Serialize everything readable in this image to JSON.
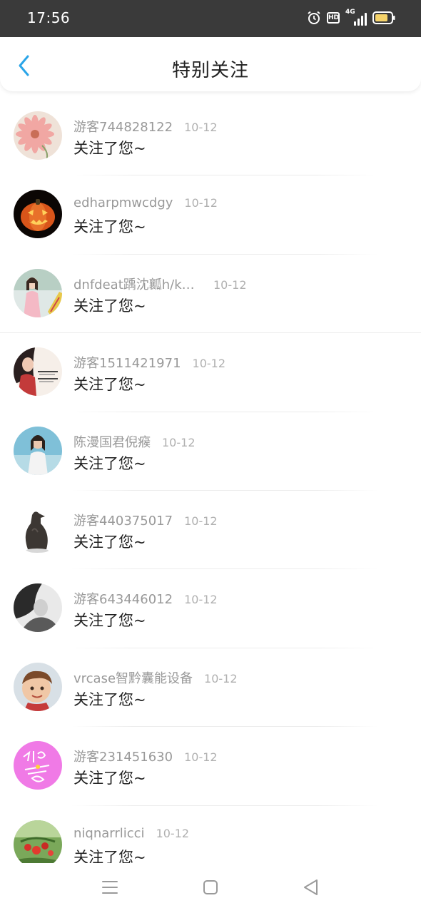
{
  "status_bar": {
    "time": "17:56",
    "network_label": "4G",
    "hd_label": "HD",
    "battery_color": "#f5d36a"
  },
  "header": {
    "title": "特别关注",
    "accent_color": "#2aa5e8"
  },
  "items": [
    {
      "name": "游客744828122",
      "date": "10-12",
      "message": "关注了您~",
      "avatar": "pink-flower"
    },
    {
      "name": "edharpmwcdgy",
      "date": "10-12",
      "message": "关注了您~",
      "avatar": "pumpkin"
    },
    {
      "name": "dnfdeat踽沈瓤h/kn...",
      "date": "10-12",
      "message": "关注了您~",
      "avatar": "girl-photo"
    },
    {
      "name": "游客1511421971",
      "date": "10-12",
      "message": "关注了您~",
      "avatar": "girl-text-card"
    },
    {
      "name": "陈漫国君倪瘊",
      "date": "10-12",
      "message": "关注了您~",
      "avatar": "beach-girl"
    },
    {
      "name": "游客440375017",
      "date": "10-12",
      "message": "关注了您~",
      "avatar": "bronze-statue"
    },
    {
      "name": "游客643446012",
      "date": "10-12",
      "message": "关注了您~",
      "avatar": "bw-portrait"
    },
    {
      "name": "vrcase智黔囊能设备",
      "date": "10-12",
      "message": "关注了您~",
      "avatar": "child-face"
    },
    {
      "name": "游客231451630",
      "date": "10-12",
      "message": "关注了您~",
      "avatar": "pink-doodle"
    },
    {
      "name": "niqnarrlicci",
      "date": "10-12",
      "message": "关注了您~",
      "avatar": "strawberry"
    }
  ],
  "bottom_nav": {
    "icons": [
      "menu-icon",
      "home-icon",
      "back-triangle-icon"
    ]
  }
}
